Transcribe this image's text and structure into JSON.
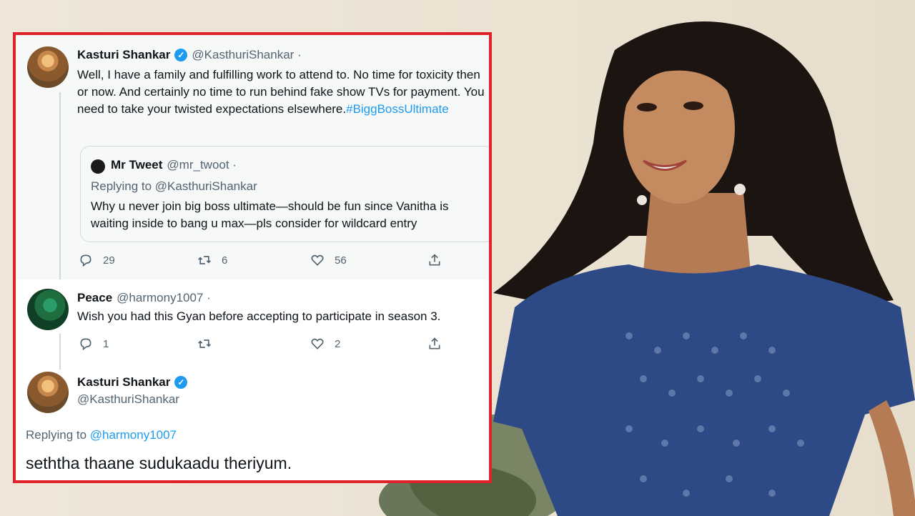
{
  "thread": {
    "tweet1": {
      "name": "Kasturi Shankar",
      "handle": "@KasthuriShankar ·",
      "text": "Well, I have a family and fulfilling work to attend to. No time for toxicity then or now. And certainly no time to run behind fake show TVs for payment. You need to take your twisted expectations elsewhere.",
      "hashtag": "#BiggBossUltimate",
      "quote": {
        "name": "Mr Tweet",
        "handle": "@mr_twoot ·",
        "replying_prefix": "Replying to",
        "replying_handle": "@KasthuriShankar",
        "text": "Why u never join big boss ultimate—should be fun since Vanitha is waiting inside to bang u max—pls consider for wildcard entry"
      },
      "replies": "29",
      "retweets": "6",
      "likes": "56"
    },
    "tweet2": {
      "name": "Peace",
      "handle": "@harmony1007 ·",
      "text": "Wish you had this Gyan before accepting to participate in season 3.",
      "replies": "1",
      "retweets": "",
      "likes": "2"
    },
    "tweet3": {
      "name": "Kasturi Shankar",
      "handle": "@KasthuriShankar",
      "replying_prefix": "Replying to",
      "replying_handle": "@harmony1007",
      "text": "seththa thaane sudukaadu theriyum."
    }
  },
  "icons": {
    "reply": "reply-icon",
    "retweet": "retweet-icon",
    "like": "heart-icon",
    "share": "share-icon",
    "verified": "verified-badge-icon"
  },
  "colors": {
    "frame": "#e0222a",
    "link": "#1d9bf0",
    "muted": "#536471",
    "text": "#0f1419"
  }
}
